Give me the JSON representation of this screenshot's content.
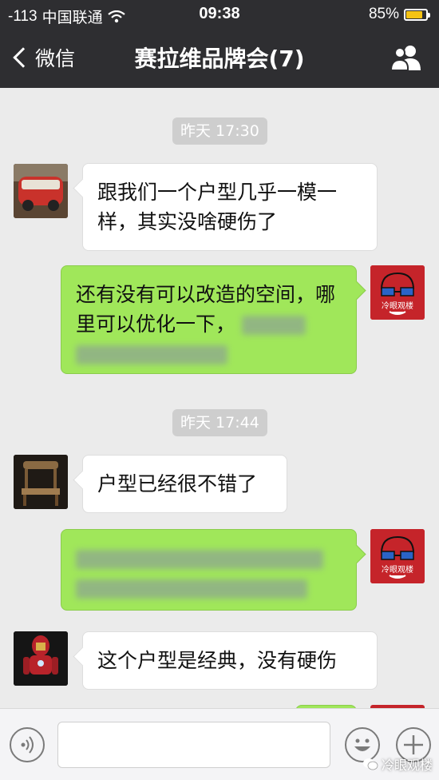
{
  "status_bar": {
    "signal": "-113",
    "carrier": "中国联通",
    "time": "09:38",
    "battery_percent": "85%",
    "battery_level": 0.85
  },
  "nav": {
    "back_label": "微信",
    "title": "赛拉维品牌会(7)"
  },
  "chat": {
    "timestamp_1": "昨天 17:30",
    "msg_1": "跟我们一个户型几乎一模一样，其实没啥硬伤了",
    "msg_2": "还有没有可以改造的空间，哪里可以优化一下，",
    "timestamp_2": "昨天 17:44",
    "msg_3": "户型已经很不错了",
    "msg_5": "这个户型是经典，没有硬伤",
    "avatar_badge_text": "冷眼观楼"
  },
  "watermark": "冷眼观楼",
  "colors": {
    "bar_bg": "#2e2e31",
    "chat_bg": "#ebebeb",
    "outgoing_bubble": "#a0e75a",
    "incoming_bubble": "#ffffff",
    "battery": "#f5c314"
  }
}
